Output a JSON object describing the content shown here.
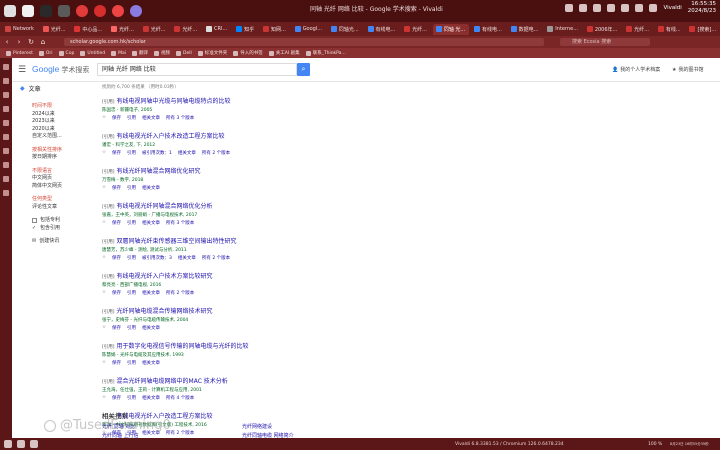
{
  "system": {
    "window_title": "同轴 光纤 网络 比较 - Google 学术搜索 - Vivaldi",
    "time": "16:55:35",
    "date": "2024/8/23",
    "user": "Vivaldi"
  },
  "tabs": [
    {
      "label": "Network",
      "color": "#c44"
    },
    {
      "label": "光纤...",
      "color": "#e55"
    },
    {
      "label": "中心品...",
      "color": "#d33"
    },
    {
      "label": "光纤...",
      "color": "#f66"
    },
    {
      "label": "光纤...",
      "color": "#c33"
    },
    {
      "label": "光纤...",
      "color": "#c33"
    },
    {
      "label": "CRI...",
      "color": "#ddd"
    },
    {
      "label": "知乎",
      "color": "#0084ff"
    },
    {
      "label": "知网...",
      "color": "#c33"
    },
    {
      "label": "Googl...",
      "color": "#4285f4"
    },
    {
      "label": "同轴光...",
      "color": "#4285f4"
    },
    {
      "label": "有线电...",
      "color": "#4285f4"
    },
    {
      "label": "光纤...",
      "color": "#c33"
    },
    {
      "label": "同轴 光...",
      "color": "#4285f4",
      "active": true
    },
    {
      "label": "有线电...",
      "color": "#4285f4"
    },
    {
      "label": "数据电...",
      "color": "#4285f4"
    },
    {
      "label": "Interne...",
      "color": "#999"
    },
    {
      "label": "2006年...",
      "color": "#c33"
    },
    {
      "label": "光纤...",
      "color": "#c33"
    },
    {
      "label": "有线...",
      "color": "#c33"
    },
    {
      "label": "[搜索]...",
      "color": "#c33"
    }
  ],
  "address": {
    "url": "scholar.google.com.hk/scholar",
    "search_placeholder": "搜索 Ecosia 搜索"
  },
  "bookmarks": [
    "Pinterest",
    "Ori",
    "Cop",
    "Untitled",
    "Mai",
    "翻译",
    "视频",
    "Dell",
    "标准文件夹",
    "导入的书签",
    "关工AI 剧集",
    "联系_ThinkPa..."
  ],
  "header": {
    "logo_google": "Google",
    "logo_sub": "学术搜索",
    "query": "同轴 光纤 网络 比较",
    "my_profile": "我的个人学术档案",
    "my_library": "我的图书馆"
  },
  "sidebar": {
    "title": "文章",
    "time_items": [
      "时间不限",
      "2024以来",
      "2023以来",
      "2020以来",
      "自定义范围..."
    ],
    "sort_items": [
      "按相关性排序",
      "按日期排序"
    ],
    "lang_items": [
      "不限语言",
      "中文网页",
      "简体中文网页"
    ],
    "type_items": [
      "任何类型",
      "评论性文章"
    ],
    "checks": [
      {
        "label": "包括专利",
        "checked": false
      },
      {
        "label": "包含引用",
        "checked": true
      }
    ],
    "alert": "创建快讯"
  },
  "results": {
    "count": "找到约 6,700 条结果 （用时0.03秒）",
    "items": [
      {
        "tag": "[引用]",
        "title": "有线电视同轴中光缆与同轴电缆特点的比较",
        "meta": "陈国忠 - 新疆电子, 2005",
        "actions": [
          "保存",
          "引用",
          "相关文章",
          "所有 3 个版本"
        ]
      },
      {
        "tag": "[引用]",
        "title": "有线电视光纤入户技术改造工程方案比较",
        "meta": "潘宏 - 科学之友, 下, 2012",
        "actions": [
          "保存",
          "引用",
          "被引用次数：1",
          "相关文章",
          "所有 2 个版本"
        ]
      },
      {
        "tag": "[引用]",
        "title": "有线光纤同轴混合网络优化研究",
        "meta": "万雪梅 - 数字, 2018",
        "actions": [
          "保存",
          "引用",
          "相关文章"
        ]
      },
      {
        "tag": "[引用]",
        "title": "有线电视光纤同轴混合网络优化分析",
        "meta": "张嘉，王中英，刘丽娟 - 广播与电视技术, 2017",
        "actions": [
          "保存",
          "引用",
          "相关文章",
          "所有 3 个版本"
        ]
      },
      {
        "tag": "[引用]",
        "title": "双層同轴光纤束传感器三维空间输出特性研究",
        "meta": "唐慧芳，苏少峰 - 测绘, 测试与分析, 2011",
        "actions": [
          "保存",
          "引用",
          "被引用次数：3",
          "相关文章",
          "所有 2 个版本"
        ]
      },
      {
        "tag": "[引用]",
        "title": "有线电视光纤入户技术方案比较研究",
        "meta": "蔡亮亮 - 西部广播电视, 2016",
        "actions": [
          "保存",
          "引用",
          "相关文章",
          "所有 2 个版本"
        ]
      },
      {
        "tag": "[引用]",
        "title": "光纤同轴电缆混合传输网络技术研究",
        "meta": "张宁，史梅芬 - 光纤与电缆传输技术, 2004",
        "actions": [
          "保存",
          "引用",
          "相关文章"
        ]
      },
      {
        "tag": "[引用]",
        "title": "用于数字化电视信号传输的同轴电缆与光纤的比较",
        "meta": "陈慧娟 - 光纤与电缆及其应用技术, 1993",
        "actions": [
          "保存",
          "引用",
          "相关文章"
        ]
      },
      {
        "tag": "[引用]",
        "title": "混合光纤同轴电缆网络中的MAC 技术分析",
        "meta": "王允海，任仕强，王莉 - 计算机工程与应用, 2001",
        "actions": [
          "保存",
          "引用",
          "相关文章",
          "所有 4 个版本"
        ]
      },
      {
        "tag": "[引用]",
        "title": "有线电视光纤入户改造工程方案比较",
        "meta": "邱洋 - 中文科技期刊数据库(引文版) 工程技术, 2016",
        "actions": [
          "保存",
          "引用",
          "相关文章",
          "所有 2 个版本"
        ]
      }
    ]
  },
  "related": {
    "title": "相关搜索",
    "items": [
      "光纤 同轴 对比",
      "光纤网络建设",
      "光纤同轴 上行信",
      "光纤同轴电缆 网络简介"
    ]
  },
  "statusbar": {
    "version": "Vivaldi 6.8.3381.53 / Chromium 126.0.6478.234",
    "zoom": "100 %",
    "clock": "8月23日 16时55分35秒"
  },
  "watermark": "@TusedEvening0"
}
